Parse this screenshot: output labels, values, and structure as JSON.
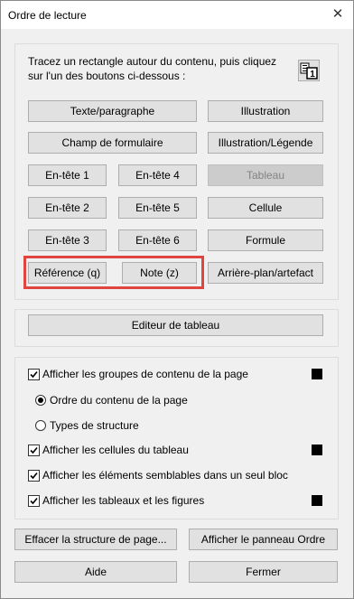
{
  "window": {
    "title": "Ordre de lecture",
    "close_glyph": "✕"
  },
  "instructions": "Tracez un rectangle autour du contenu, puis cliquez sur l'un des boutons ci-dessous :",
  "tag_buttons": {
    "texte_paragraphe": "Texte/paragraphe",
    "illustration": "Illustration",
    "champ_formulaire": "Champ de formulaire",
    "illustration_legende": "Illustration/Légende",
    "entete1": "En-tête 1",
    "entete4": "En-tête 4",
    "tableau": "Tableau",
    "entete2": "En-tête 2",
    "entete5": "En-tête 5",
    "cellule": "Cellule",
    "entete3": "En-tête 3",
    "entete6": "En-tête 6",
    "formule": "Formule",
    "reference": "Référence (q)",
    "note": "Note (z)",
    "arriere_plan": "Arrière-plan/artefact"
  },
  "table_editor": "Editeur de tableau",
  "options": {
    "show_groups": {
      "label": "Afficher les groupes de contenu de la page",
      "checked": true
    },
    "order_content": {
      "label": "Ordre du contenu de la page",
      "selected": true
    },
    "structure_types": {
      "label": "Types de structure",
      "selected": false
    },
    "show_cells": {
      "label": "Afficher les cellules du tableau",
      "checked": true
    },
    "similar_elements": {
      "label": "Afficher les éléments semblables dans un seul bloc",
      "checked": true
    },
    "show_tables_figures": {
      "label": "Afficher les tableaux et les figures",
      "checked": true
    }
  },
  "footer": {
    "clear_structure": "Effacer la structure de page...",
    "show_order_panel": "Afficher le panneau Ordre",
    "help": "Aide",
    "close": "Fermer"
  },
  "colors": {
    "highlight": "#e0463f",
    "swatch": "#000000"
  },
  "icons": {
    "close": "close-icon",
    "table-order": "table-order-icon"
  }
}
